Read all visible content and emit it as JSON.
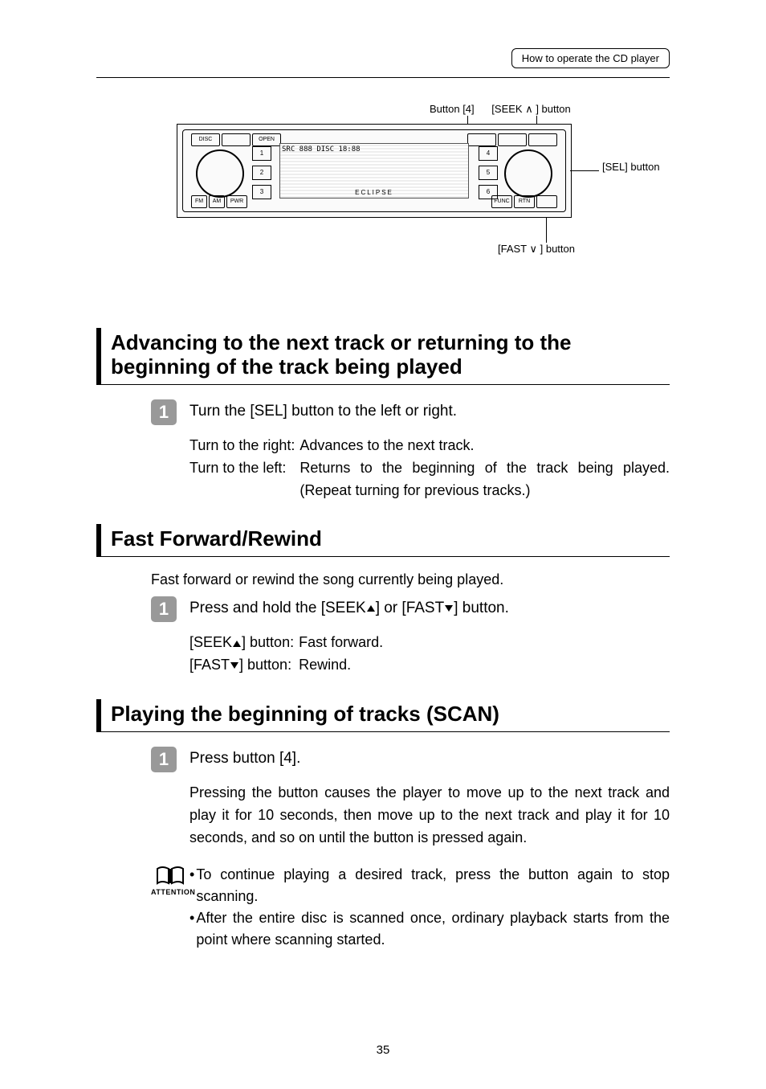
{
  "header": {
    "section_title": "How to operate the CD player"
  },
  "diagram": {
    "labels": {
      "button4": "Button [4]",
      "seek": "[SEEK ∧ ] button",
      "sel": "[SEL] button",
      "fast": "[FAST ∨ ] button"
    },
    "brand": "ECLIPSE"
  },
  "sections": [
    {
      "heading": "Advancing to the next track or returning to the beginning of the track being played",
      "steps": [
        {
          "num": "1",
          "text": "Turn the [SEL] button to the left or right."
        }
      ],
      "definitions": [
        {
          "key": "Turn to the right:",
          "val": "Advances to the next track."
        },
        {
          "key": "Turn to the left:",
          "val": "Returns to the beginning of the track being played. (Repeat turning for previous tracks.)"
        }
      ]
    },
    {
      "heading": "Fast Forward/Rewind",
      "intro": "Fast forward or rewind the song currently being played.",
      "steps": [
        {
          "num": "1",
          "text_pre": "Press and hold the [SEEK",
          "text_mid": "] or [FAST",
          "text_post": "] button."
        }
      ],
      "definitions": [
        {
          "key_pre": "[SEEK",
          "key_post": "] button:",
          "val": "Fast forward."
        },
        {
          "key_pre": "[FAST",
          "key_post": "] button:",
          "val": "Rewind."
        }
      ]
    },
    {
      "heading": "Playing the beginning of tracks (SCAN)",
      "steps": [
        {
          "num": "1",
          "text": "Press button [4]."
        }
      ],
      "paragraph": "Pressing the button causes the player to move up to the next track and play it for 10 seconds, then move up to the next track and play it for 10 seconds, and so on until the button is pressed again.",
      "attention": {
        "label": "ATTENTION",
        "items": [
          "To continue playing a desired track, press the button again to stop scanning.",
          "After the entire disc is scanned once, ordinary playback starts from the point where scanning started."
        ]
      }
    }
  ],
  "page_number": "35"
}
